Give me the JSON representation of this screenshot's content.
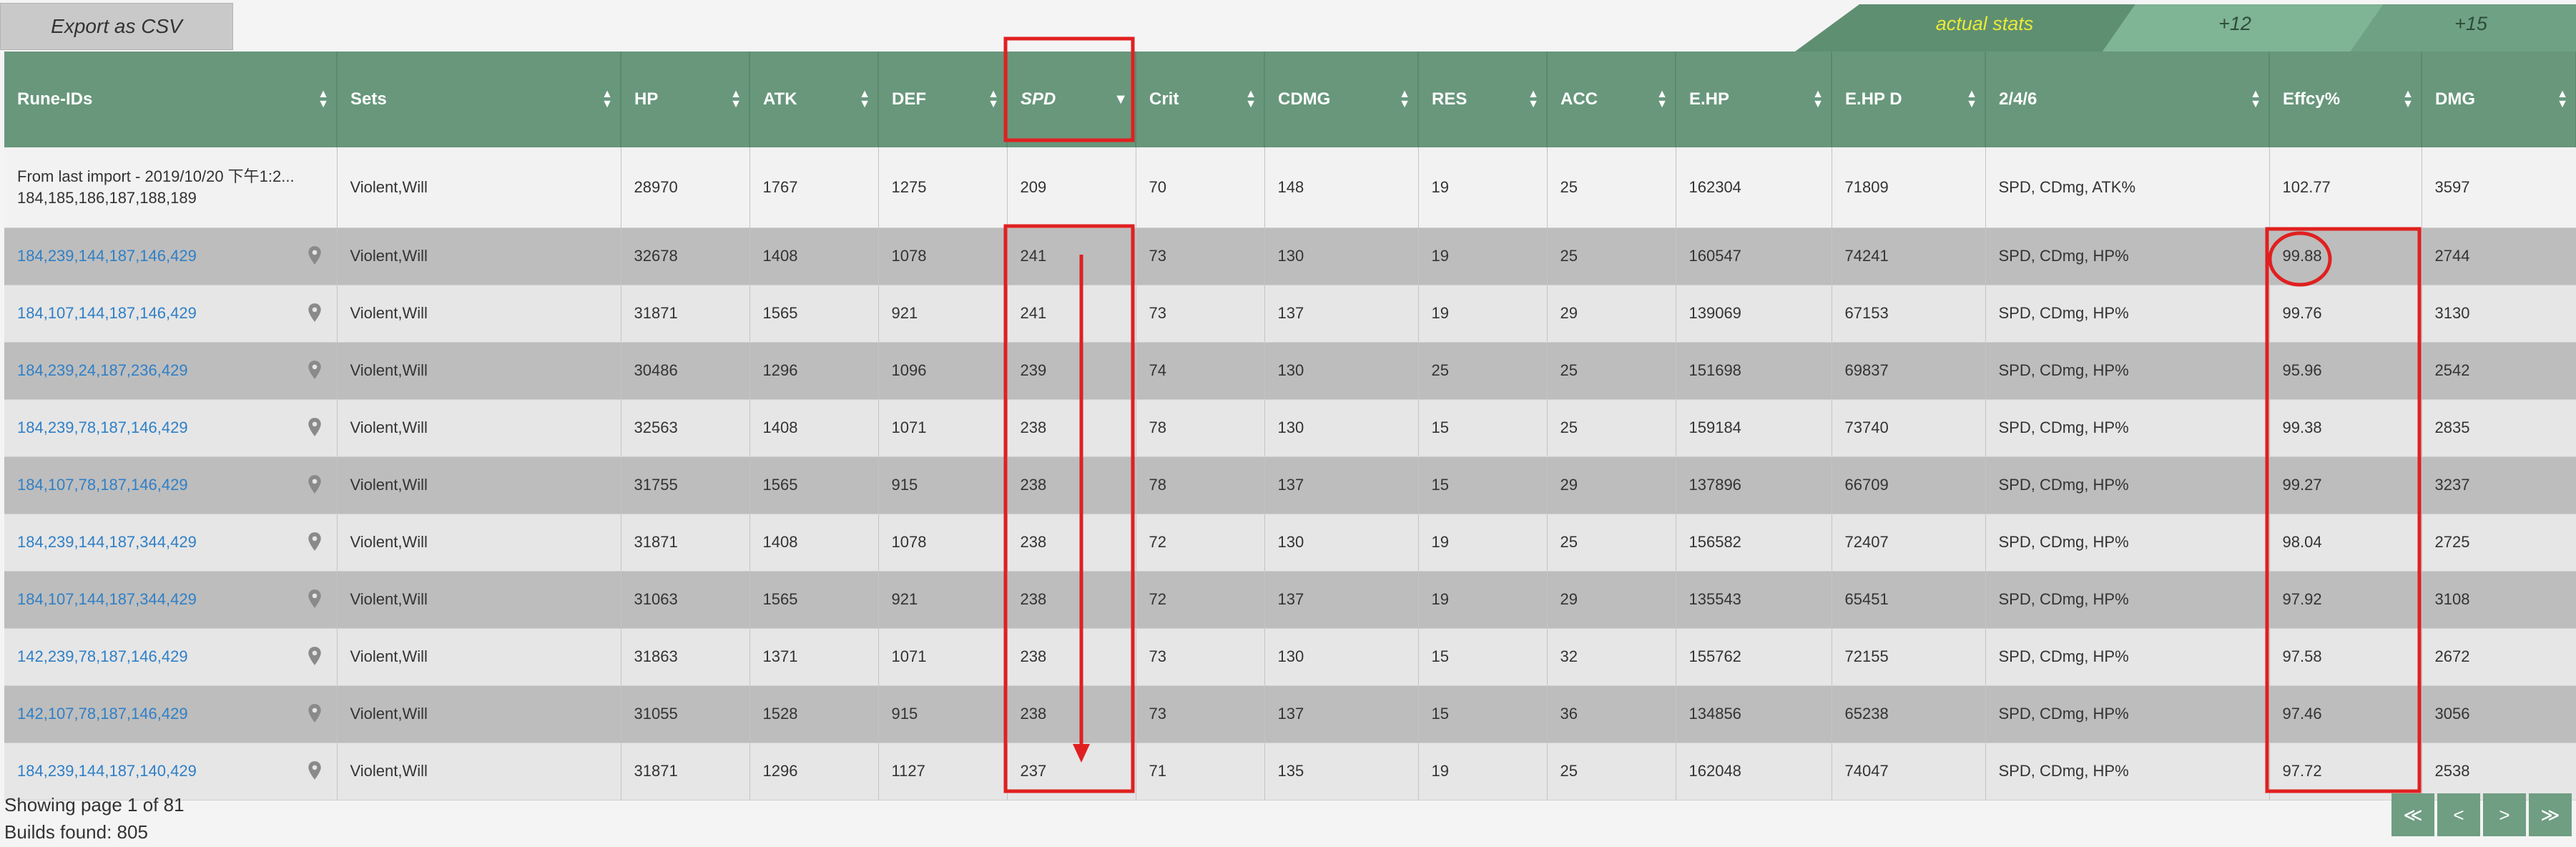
{
  "toolbar": {
    "export_label": "Export as CSV"
  },
  "stat_tabs": [
    {
      "label": "actual stats",
      "active": true
    },
    {
      "label": "+12",
      "active": false
    },
    {
      "label": "+15",
      "active": false
    }
  ],
  "table": {
    "headers": [
      "Rune-IDs",
      "Sets",
      "HP",
      "ATK",
      "DEF",
      "SPD",
      "Crit",
      "CDMG",
      "RES",
      "ACC",
      "E.HP",
      "E.HP D",
      "2/4/6",
      "Effcy%",
      "DMG"
    ],
    "sorted_column": "SPD",
    "first_row": {
      "line1": "From last import - 2019/10/20 下午1:2...",
      "line2": "184,185,186,187,188,189",
      "cells": [
        "Violent,Will",
        "28970",
        "1767",
        "1275",
        "209",
        "70",
        "148",
        "19",
        "25",
        "162304",
        "71809",
        "SPD, CDmg, ATK%",
        "102.77",
        "3597"
      ]
    },
    "rows": [
      {
        "runes": "184,239,144,187,146,429",
        "cells": [
          "Violent,Will",
          "32678",
          "1408",
          "1078",
          "241",
          "73",
          "130",
          "19",
          "25",
          "160547",
          "74241",
          "SPD, CDmg, HP%",
          "99.88",
          "2744"
        ]
      },
      {
        "runes": "184,107,144,187,146,429",
        "cells": [
          "Violent,Will",
          "31871",
          "1565",
          "921",
          "241",
          "73",
          "137",
          "19",
          "29",
          "139069",
          "67153",
          "SPD, CDmg, HP%",
          "99.76",
          "3130"
        ]
      },
      {
        "runes": "184,239,24,187,236,429",
        "cells": [
          "Violent,Will",
          "30486",
          "1296",
          "1096",
          "239",
          "74",
          "130",
          "25",
          "25",
          "151698",
          "69837",
          "SPD, CDmg, HP%",
          "95.96",
          "2542"
        ]
      },
      {
        "runes": "184,239,78,187,146,429",
        "cells": [
          "Violent,Will",
          "32563",
          "1408",
          "1071",
          "238",
          "78",
          "130",
          "15",
          "25",
          "159184",
          "73740",
          "SPD, CDmg, HP%",
          "99.38",
          "2835"
        ]
      },
      {
        "runes": "184,107,78,187,146,429",
        "cells": [
          "Violent,Will",
          "31755",
          "1565",
          "915",
          "238",
          "78",
          "137",
          "15",
          "29",
          "137896",
          "66709",
          "SPD, CDmg, HP%",
          "99.27",
          "3237"
        ]
      },
      {
        "runes": "184,239,144,187,344,429",
        "cells": [
          "Violent,Will",
          "31871",
          "1408",
          "1078",
          "238",
          "72",
          "130",
          "19",
          "25",
          "156582",
          "72407",
          "SPD, CDmg, HP%",
          "98.04",
          "2725"
        ]
      },
      {
        "runes": "184,107,144,187,344,429",
        "cells": [
          "Violent,Will",
          "31063",
          "1565",
          "921",
          "238",
          "72",
          "137",
          "19",
          "29",
          "135543",
          "65451",
          "SPD, CDmg, HP%",
          "97.92",
          "3108"
        ]
      },
      {
        "runes": "142,239,78,187,146,429",
        "cells": [
          "Violent,Will",
          "31863",
          "1371",
          "1071",
          "238",
          "73",
          "130",
          "15",
          "32",
          "155762",
          "72155",
          "SPD, CDmg, HP%",
          "97.58",
          "2672"
        ]
      },
      {
        "runes": "142,107,78,187,146,429",
        "cells": [
          "Violent,Will",
          "31055",
          "1528",
          "915",
          "238",
          "73",
          "137",
          "15",
          "36",
          "134856",
          "65238",
          "SPD, CDmg, HP%",
          "97.46",
          "3056"
        ]
      },
      {
        "runes": "184,239,144,187,140,429",
        "cells": [
          "Violent,Will",
          "31871",
          "1296",
          "1127",
          "237",
          "71",
          "135",
          "19",
          "25",
          "162048",
          "74047",
          "SPD, CDmg, HP%",
          "97.72",
          "2538"
        ]
      }
    ]
  },
  "footer": {
    "page_text": "Showing page 1 of 81",
    "builds_text": "Builds found: 805"
  },
  "pagination": {
    "first": "≪",
    "prev": "<",
    "next": ">",
    "last": "≫"
  },
  "colors": {
    "header_bg": "#68977c",
    "link": "#2f7fc6",
    "active_tab_text": "#e9e93a",
    "annotation_red": "#e02020"
  }
}
